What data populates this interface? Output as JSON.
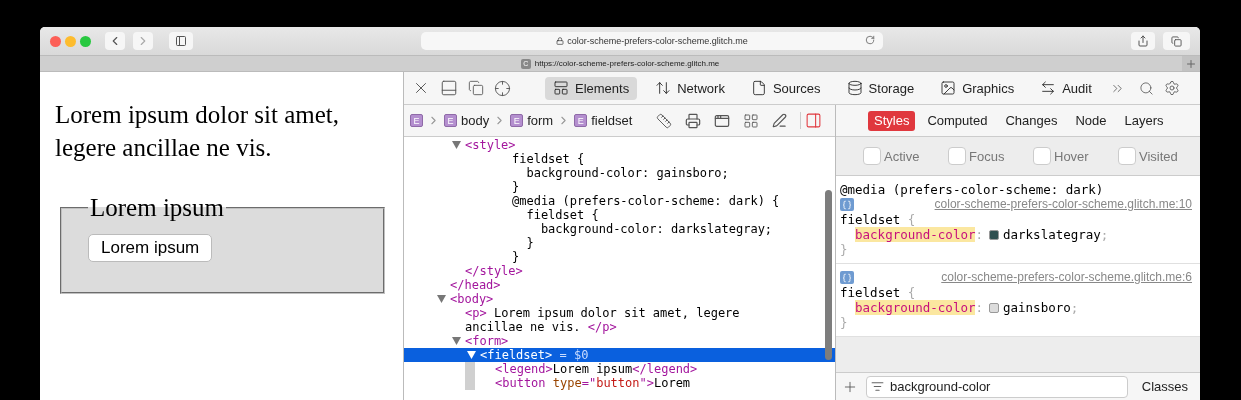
{
  "browser": {
    "address": "color-scheme-prefers-color-scheme.glitch.me",
    "tab": {
      "favicon": "C",
      "title": "https://color-scheme-prefers-color-scheme.glitch.me"
    }
  },
  "page": {
    "paragraph": "Lorem ipsum dolor sit amet, legere ancillae ne vis.",
    "fieldset": {
      "legend": "Lorem ipsum",
      "button": "Lorem ipsum"
    }
  },
  "devtools": {
    "tabs": [
      {
        "label": "Elements",
        "kind": "elements",
        "selected": true
      },
      {
        "label": "Network",
        "kind": "network",
        "selected": false
      },
      {
        "label": "Sources",
        "kind": "sources",
        "selected": false
      },
      {
        "label": "Storage",
        "kind": "storage",
        "selected": false
      },
      {
        "label": "Graphics",
        "kind": "graphics",
        "selected": false
      },
      {
        "label": "Audit",
        "kind": "audit",
        "selected": false
      }
    ],
    "breadcrumbs": [
      {
        "badge": "E"
      },
      {
        "badge": "E",
        "label": "body"
      },
      {
        "badge": "E",
        "label": "form"
      },
      {
        "badge": "E",
        "label": "fieldset"
      }
    ],
    "dom_tree": [
      {
        "kind": "element",
        "close": [
          {
            "kind": "tag",
            "text": "</head>"
          }
        ],
        "children": [
          {
            "kind": "element",
            "parts": [
              {
                "kind": "tag",
                "text": "<style>"
              }
            ],
            "expanded": true,
            "selected": false,
            "close": [
              {
                "kind": "tag",
                "text": "</style>"
              }
            ],
            "children": [
              {
                "kind": "raw",
                "text": "fieldset {\n  background-color: gainsboro;\n}\n@media (prefers-color-scheme: dark) {\n  fieldset {\n    background-color: darkslategray;\n  }\n}"
              }
            ]
          }
        ]
      },
      {
        "kind": "element",
        "parts": [
          {
            "kind": "tag",
            "text": "<body>"
          }
        ],
        "expanded": true,
        "selected": false,
        "children": [
          {
            "kind": "element",
            "parts": [
              {
                "kind": "tag",
                "text": "<p>"
              },
              {
                "kind": "text",
                "text": " Lorem ipsum dolor sit amet, legere ancillae ne vis. "
              },
              {
                "kind": "tag",
                "text": "</p>"
              }
            ],
            "selected": false
          },
          {
            "kind": "element",
            "parts": [
              {
                "kind": "tag",
                "text": "<form>"
              }
            ],
            "expanded": true,
            "selected": false,
            "children": [
              {
                "kind": "element",
                "parts": [
                  {
                    "kind": "tag",
                    "text": "<fieldset>"
                  },
                  {
                    "kind": "ref",
                    "text": " = $0"
                  }
                ],
                "expanded": true,
                "selected": true,
                "children": [
                  {
                    "kind": "element",
                    "parts": [
                      {
                        "kind": "tag",
                        "text": "<legend>"
                      },
                      {
                        "kind": "text",
                        "text": "Lorem ipsum"
                      },
                      {
                        "kind": "tag",
                        "text": "</legend>"
                      }
                    ],
                    "selected": false
                  },
                  {
                    "kind": "element",
                    "parts": [
                      {
                        "kind": "tag",
                        "text": "<button "
                      },
                      {
                        "kind": "attr",
                        "text": "type"
                      },
                      {
                        "kind": "tag",
                        "text": "=\""
                      },
                      {
                        "kind": "value",
                        "text": "button"
                      },
                      {
                        "kind": "tag",
                        "text": "\">"
                      },
                      {
                        "kind": "text",
                        "text": "Lorem"
                      }
                    ],
                    "selected": false
                  }
                ]
              }
            ]
          }
        ]
      }
    ],
    "styles": {
      "tabs": [
        {
          "label": "Styles",
          "selected": true
        },
        {
          "label": "Computed",
          "selected": false
        },
        {
          "label": "Changes",
          "selected": false
        },
        {
          "label": "Node",
          "selected": false
        },
        {
          "label": "Layers",
          "selected": false
        }
      ],
      "pseudo_states": [
        {
          "label": "Active",
          "checked": false
        },
        {
          "label": "Focus",
          "checked": false
        },
        {
          "label": "Hover",
          "checked": false
        },
        {
          "label": "Visited",
          "checked": false
        }
      ],
      "rules": [
        {
          "media": "@media (prefers-color-scheme: dark)",
          "source": "color-scheme-prefers-color-scheme.glitch.me:10",
          "selector": "fieldset",
          "open": "{",
          "close": "}",
          "declarations": [
            {
              "property": "background-color",
              "colon": ":",
              "value": "darkslategray",
              "end": ";",
              "color": "#2f4f4f"
            }
          ]
        },
        {
          "source": "color-scheme-prefers-color-scheme.glitch.me:6",
          "selector": "fieldset",
          "open": "{",
          "close": "}",
          "declarations": [
            {
              "property": "background-color",
              "colon": ":",
              "value": "gainsboro",
              "end": ";",
              "color": "#dcdcdc"
            }
          ]
        }
      ],
      "filter": {
        "value": "background-color"
      },
      "classes_button": "Classes"
    }
  }
}
